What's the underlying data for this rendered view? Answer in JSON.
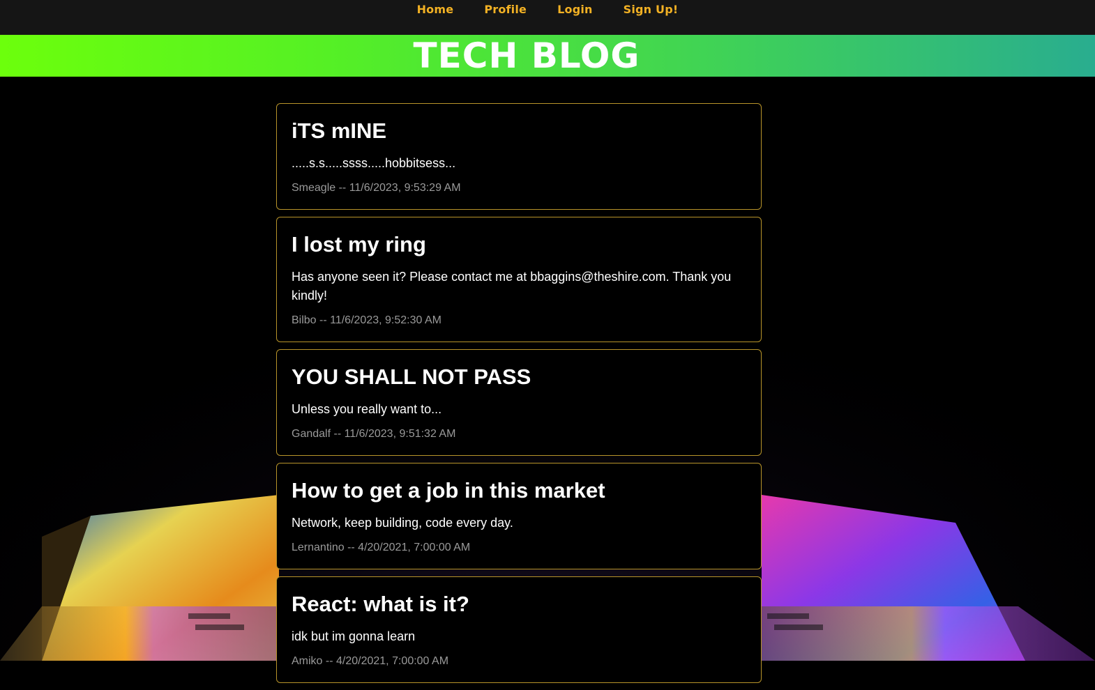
{
  "nav": {
    "items": [
      {
        "label": "Home"
      },
      {
        "label": "Profile"
      },
      {
        "label": "Login"
      },
      {
        "label": "Sign Up!"
      }
    ]
  },
  "banner": {
    "title": "TECH BLOG"
  },
  "posts": [
    {
      "title": "iTS mINE",
      "body": ".....s.s.....ssss.....hobbitsess...",
      "author": "Smeagle",
      "date": "11/6/2023, 9:53:29 AM",
      "meta": "Smeagle -- 11/6/2023, 9:53:29 AM"
    },
    {
      "title": "I lost my ring",
      "body": "Has anyone seen it? Please contact me at bbaggins@theshire.com. Thank you kindly!",
      "author": "Bilbo",
      "date": "11/6/2023, 9:52:30 AM",
      "meta": "Bilbo -- 11/6/2023, 9:52:30 AM"
    },
    {
      "title": "YOU SHALL NOT PASS",
      "body": "Unless you really want to...",
      "author": "Gandalf",
      "date": "11/6/2023, 9:51:32 AM",
      "meta": "Gandalf -- 11/6/2023, 9:51:32 AM"
    },
    {
      "title": "How to get a job in this market",
      "body": "Network, keep building, code every day.",
      "author": "Lernantino",
      "date": "4/20/2021, 7:00:00 AM",
      "meta": "Lernantino -- 4/20/2021, 7:00:00 AM"
    },
    {
      "title": "React: what is it?",
      "body": "idk but im gonna learn",
      "author": "Amiko",
      "date": "4/20/2021, 7:00:00 AM",
      "meta": "Amiko -- 4/20/2021, 7:00:00 AM"
    }
  ],
  "colors": {
    "nav_bg": "#151515",
    "nav_link": "#f2b124",
    "banner_gradient_start": "#6cff0c",
    "banner_gradient_end": "#29ad8f",
    "card_border": "#b8942a",
    "meta_text": "#9a9a9a"
  }
}
